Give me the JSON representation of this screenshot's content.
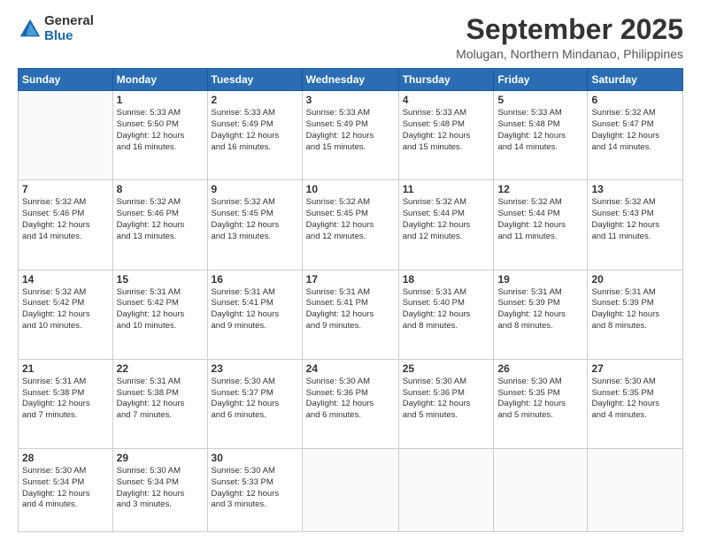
{
  "logo": {
    "general": "General",
    "blue": "Blue"
  },
  "header": {
    "month": "September 2025",
    "location": "Molugan, Northern Mindanao, Philippines"
  },
  "weekdays": [
    "Sunday",
    "Monday",
    "Tuesday",
    "Wednesday",
    "Thursday",
    "Friday",
    "Saturday"
  ],
  "weeks": [
    [
      {
        "day": "",
        "sunrise": "",
        "sunset": "",
        "daylight": ""
      },
      {
        "day": "1",
        "sunrise": "Sunrise: 5:33 AM",
        "sunset": "Sunset: 5:50 PM",
        "daylight": "Daylight: 12 hours and 16 minutes."
      },
      {
        "day": "2",
        "sunrise": "Sunrise: 5:33 AM",
        "sunset": "Sunset: 5:49 PM",
        "daylight": "Daylight: 12 hours and 16 minutes."
      },
      {
        "day": "3",
        "sunrise": "Sunrise: 5:33 AM",
        "sunset": "Sunset: 5:49 PM",
        "daylight": "Daylight: 12 hours and 15 minutes."
      },
      {
        "day": "4",
        "sunrise": "Sunrise: 5:33 AM",
        "sunset": "Sunset: 5:48 PM",
        "daylight": "Daylight: 12 hours and 15 minutes."
      },
      {
        "day": "5",
        "sunrise": "Sunrise: 5:33 AM",
        "sunset": "Sunset: 5:48 PM",
        "daylight": "Daylight: 12 hours and 14 minutes."
      },
      {
        "day": "6",
        "sunrise": "Sunrise: 5:32 AM",
        "sunset": "Sunset: 5:47 PM",
        "daylight": "Daylight: 12 hours and 14 minutes."
      }
    ],
    [
      {
        "day": "7",
        "sunrise": "Sunrise: 5:32 AM",
        "sunset": "Sunset: 5:46 PM",
        "daylight": "Daylight: 12 hours and 14 minutes."
      },
      {
        "day": "8",
        "sunrise": "Sunrise: 5:32 AM",
        "sunset": "Sunset: 5:46 PM",
        "daylight": "Daylight: 12 hours and 13 minutes."
      },
      {
        "day": "9",
        "sunrise": "Sunrise: 5:32 AM",
        "sunset": "Sunset: 5:45 PM",
        "daylight": "Daylight: 12 hours and 13 minutes."
      },
      {
        "day": "10",
        "sunrise": "Sunrise: 5:32 AM",
        "sunset": "Sunset: 5:45 PM",
        "daylight": "Daylight: 12 hours and 12 minutes."
      },
      {
        "day": "11",
        "sunrise": "Sunrise: 5:32 AM",
        "sunset": "Sunset: 5:44 PM",
        "daylight": "Daylight: 12 hours and 12 minutes."
      },
      {
        "day": "12",
        "sunrise": "Sunrise: 5:32 AM",
        "sunset": "Sunset: 5:44 PM",
        "daylight": "Daylight: 12 hours and 11 minutes."
      },
      {
        "day": "13",
        "sunrise": "Sunrise: 5:32 AM",
        "sunset": "Sunset: 5:43 PM",
        "daylight": "Daylight: 12 hours and 11 minutes."
      }
    ],
    [
      {
        "day": "14",
        "sunrise": "Sunrise: 5:32 AM",
        "sunset": "Sunset: 5:42 PM",
        "daylight": "Daylight: 12 hours and 10 minutes."
      },
      {
        "day": "15",
        "sunrise": "Sunrise: 5:31 AM",
        "sunset": "Sunset: 5:42 PM",
        "daylight": "Daylight: 12 hours and 10 minutes."
      },
      {
        "day": "16",
        "sunrise": "Sunrise: 5:31 AM",
        "sunset": "Sunset: 5:41 PM",
        "daylight": "Daylight: 12 hours and 9 minutes."
      },
      {
        "day": "17",
        "sunrise": "Sunrise: 5:31 AM",
        "sunset": "Sunset: 5:41 PM",
        "daylight": "Daylight: 12 hours and 9 minutes."
      },
      {
        "day": "18",
        "sunrise": "Sunrise: 5:31 AM",
        "sunset": "Sunset: 5:40 PM",
        "daylight": "Daylight: 12 hours and 8 minutes."
      },
      {
        "day": "19",
        "sunrise": "Sunrise: 5:31 AM",
        "sunset": "Sunset: 5:39 PM",
        "daylight": "Daylight: 12 hours and 8 minutes."
      },
      {
        "day": "20",
        "sunrise": "Sunrise: 5:31 AM",
        "sunset": "Sunset: 5:39 PM",
        "daylight": "Daylight: 12 hours and 8 minutes."
      }
    ],
    [
      {
        "day": "21",
        "sunrise": "Sunrise: 5:31 AM",
        "sunset": "Sunset: 5:38 PM",
        "daylight": "Daylight: 12 hours and 7 minutes."
      },
      {
        "day": "22",
        "sunrise": "Sunrise: 5:31 AM",
        "sunset": "Sunset: 5:38 PM",
        "daylight": "Daylight: 12 hours and 7 minutes."
      },
      {
        "day": "23",
        "sunrise": "Sunrise: 5:30 AM",
        "sunset": "Sunset: 5:37 PM",
        "daylight": "Daylight: 12 hours and 6 minutes."
      },
      {
        "day": "24",
        "sunrise": "Sunrise: 5:30 AM",
        "sunset": "Sunset: 5:36 PM",
        "daylight": "Daylight: 12 hours and 6 minutes."
      },
      {
        "day": "25",
        "sunrise": "Sunrise: 5:30 AM",
        "sunset": "Sunset: 5:36 PM",
        "daylight": "Daylight: 12 hours and 5 minutes."
      },
      {
        "day": "26",
        "sunrise": "Sunrise: 5:30 AM",
        "sunset": "Sunset: 5:35 PM",
        "daylight": "Daylight: 12 hours and 5 minutes."
      },
      {
        "day": "27",
        "sunrise": "Sunrise: 5:30 AM",
        "sunset": "Sunset: 5:35 PM",
        "daylight": "Daylight: 12 hours and 4 minutes."
      }
    ],
    [
      {
        "day": "28",
        "sunrise": "Sunrise: 5:30 AM",
        "sunset": "Sunset: 5:34 PM",
        "daylight": "Daylight: 12 hours and 4 minutes."
      },
      {
        "day": "29",
        "sunrise": "Sunrise: 5:30 AM",
        "sunset": "Sunset: 5:34 PM",
        "daylight": "Daylight: 12 hours and 3 minutes."
      },
      {
        "day": "30",
        "sunrise": "Sunrise: 5:30 AM",
        "sunset": "Sunset: 5:33 PM",
        "daylight": "Daylight: 12 hours and 3 minutes."
      },
      {
        "day": "",
        "sunrise": "",
        "sunset": "",
        "daylight": ""
      },
      {
        "day": "",
        "sunrise": "",
        "sunset": "",
        "daylight": ""
      },
      {
        "day": "",
        "sunrise": "",
        "sunset": "",
        "daylight": ""
      },
      {
        "day": "",
        "sunrise": "",
        "sunset": "",
        "daylight": ""
      }
    ]
  ]
}
